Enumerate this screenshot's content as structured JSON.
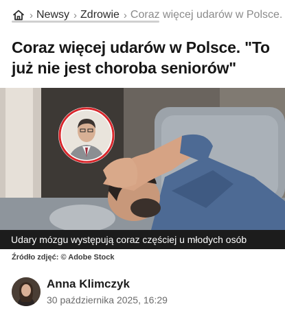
{
  "breadcrumb": {
    "home_icon": "home-icon",
    "items": [
      {
        "label": "Newsy"
      },
      {
        "label": "Zdrowie"
      },
      {
        "label": "Coraz więcej udarów w Polsce. \"To już nie jest choroba seniorów\""
      }
    ],
    "separator": "›"
  },
  "article": {
    "title": "Coraz więcej udarów w Polsce. \"To już nie jest choroba seniorów\"",
    "image_caption": "Udary mózgu występują coraz częściej u młodych osób",
    "photo_source": "Źródło zdjęć: © Adobe Stock",
    "author": {
      "name": "Anna Klimczyk",
      "date": "30 października 2025, 16:29"
    }
  },
  "colors": {
    "caption_bg": "#1c1c1c",
    "inset_ring": "#d8262b",
    "text": "#161616",
    "muted": "#8a8a8a"
  }
}
